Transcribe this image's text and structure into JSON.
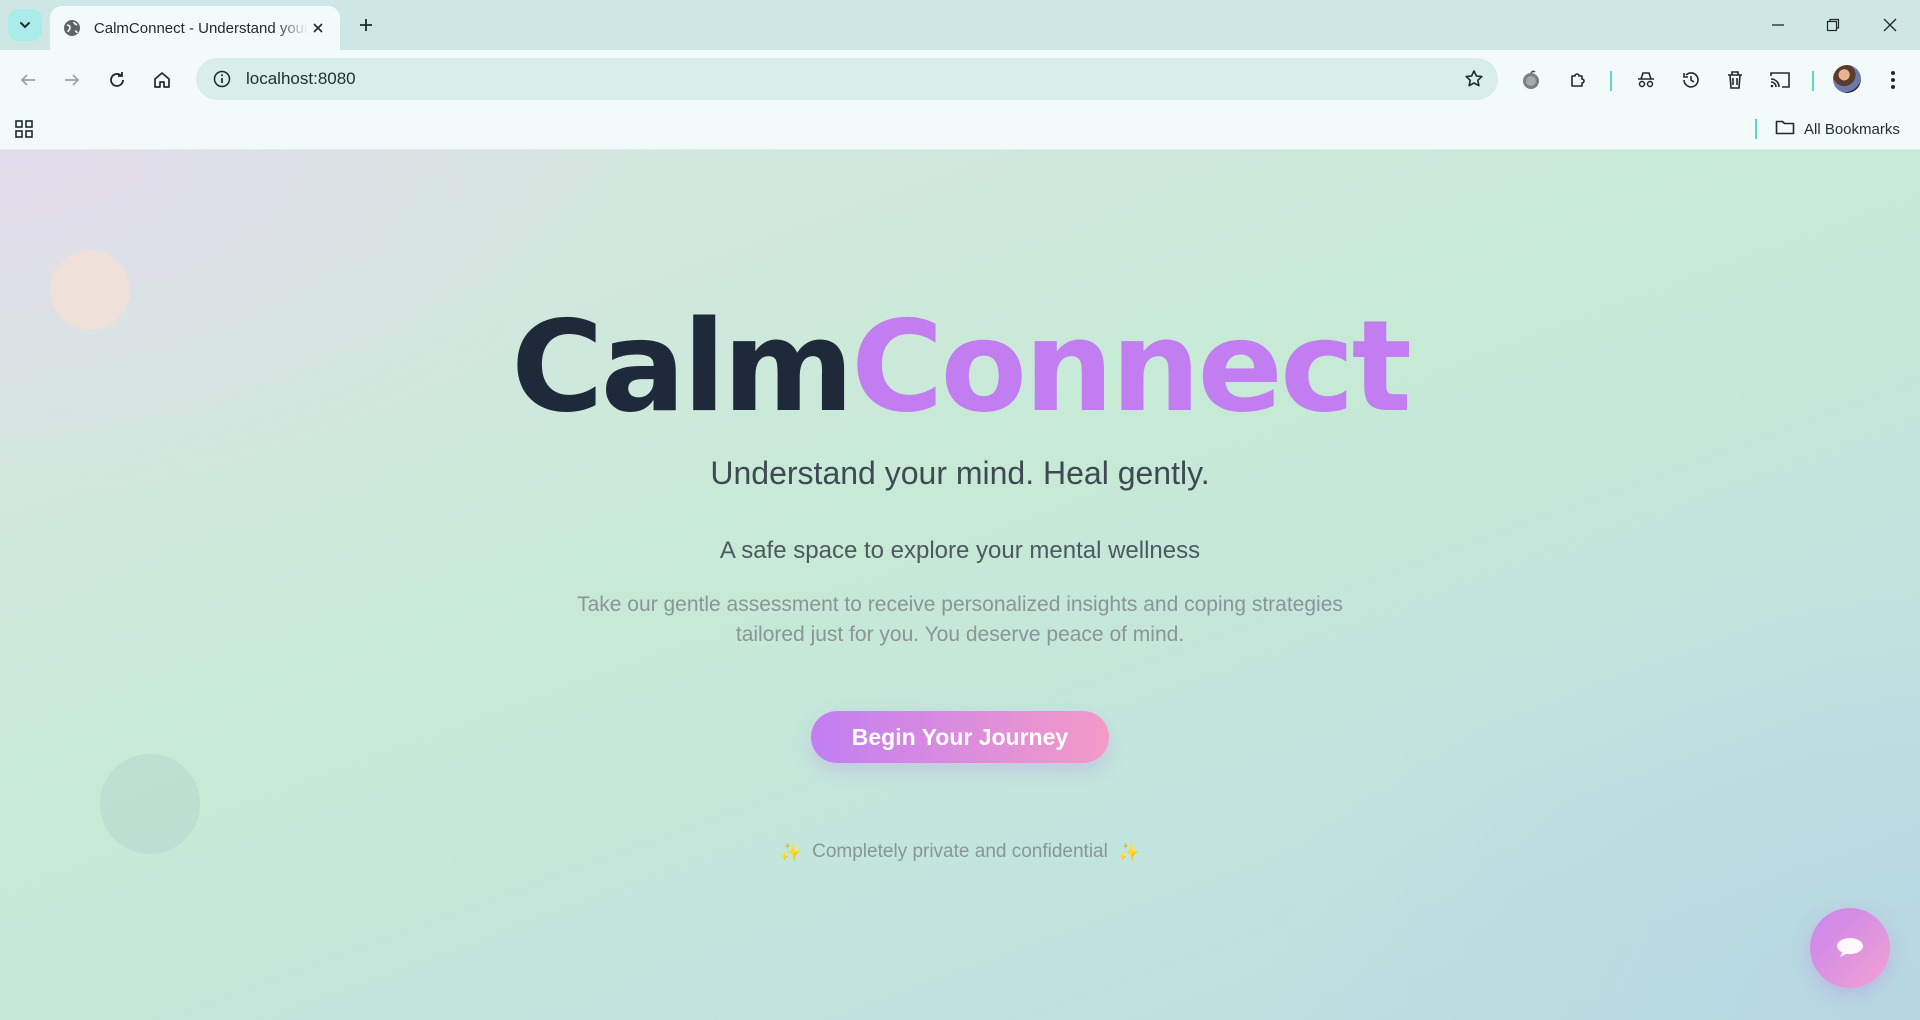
{
  "browser": {
    "tab_title": "CalmConnect - Understand your mind. Heal gently.",
    "url": "localhost:8080",
    "bookmarks_label": "All Bookmarks"
  },
  "hero": {
    "title_part1": "Calm",
    "title_part2": "Connect",
    "tagline": "Understand your mind. Heal gently.",
    "subheading": "A safe space to explore your mental wellness",
    "description": "Take our gentle assessment to receive personalized insights and coping strategies tailored just for you. You deserve peace of mind.",
    "cta_label": "Begin Your Journey",
    "privacy_note": "Completely private and confidential",
    "sparkle": "✨"
  },
  "colors": {
    "title_dark": "#1e2a3a",
    "title_accent": "#c27ef0",
    "cta_gradient_start": "#c17ef2",
    "cta_gradient_end": "#f49ac8"
  },
  "icons": [
    "tab-search-icon",
    "globe-icon",
    "close-icon",
    "plus-icon",
    "minimize-icon",
    "restore-icon",
    "back-icon",
    "forward-icon",
    "reload-icon",
    "home-icon",
    "info-icon",
    "star-icon",
    "extension-icon",
    "puzzle-icon",
    "incognito-icon",
    "history-icon",
    "trash-icon",
    "cast-icon",
    "kebab-menu-icon",
    "apps-grid-icon",
    "folder-icon",
    "chat-bubble-icon"
  ]
}
